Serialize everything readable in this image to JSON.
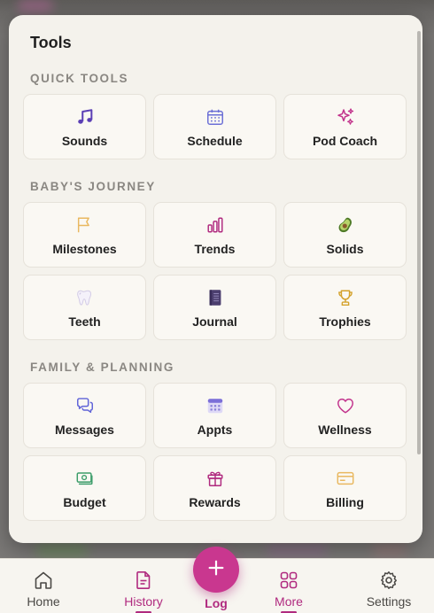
{
  "sheet": {
    "title": "Tools"
  },
  "sections": [
    {
      "label": "QUICK TOOLS",
      "tiles": [
        {
          "label": "Sounds",
          "icon": "music-note-icon"
        },
        {
          "label": "Schedule",
          "icon": "calendar-icon"
        },
        {
          "label": "Pod Coach",
          "icon": "sparkles-icon"
        }
      ]
    },
    {
      "label": "BABY'S JOURNEY",
      "tiles": [
        {
          "label": "Milestones",
          "icon": "flag-icon"
        },
        {
          "label": "Trends",
          "icon": "bar-chart-icon"
        },
        {
          "label": "Solids",
          "icon": "avocado-icon"
        },
        {
          "label": "Teeth",
          "icon": "tooth-icon"
        },
        {
          "label": "Journal",
          "icon": "notebook-icon"
        },
        {
          "label": "Trophies",
          "icon": "trophy-icon"
        }
      ]
    },
    {
      "label": "FAMILY & PLANNING",
      "tiles": [
        {
          "label": "Messages",
          "icon": "chat-bubbles-icon"
        },
        {
          "label": "Appts",
          "icon": "calendar-grid-icon"
        },
        {
          "label": "Wellness",
          "icon": "heart-icon"
        },
        {
          "label": "Budget",
          "icon": "money-icon"
        },
        {
          "label": "Rewards",
          "icon": "gift-icon"
        },
        {
          "label": "Billing",
          "icon": "credit-card-icon"
        }
      ]
    }
  ],
  "nav": {
    "home": "Home",
    "history": "History",
    "log": "Log",
    "more": "More",
    "settings": "Settings",
    "active": [
      "History",
      "More"
    ]
  },
  "colors": {
    "accent": "#b02a7f",
    "fab": "#c9378f",
    "purple": "#6b4fc9",
    "sheet_bg": "#f4f2ec"
  }
}
